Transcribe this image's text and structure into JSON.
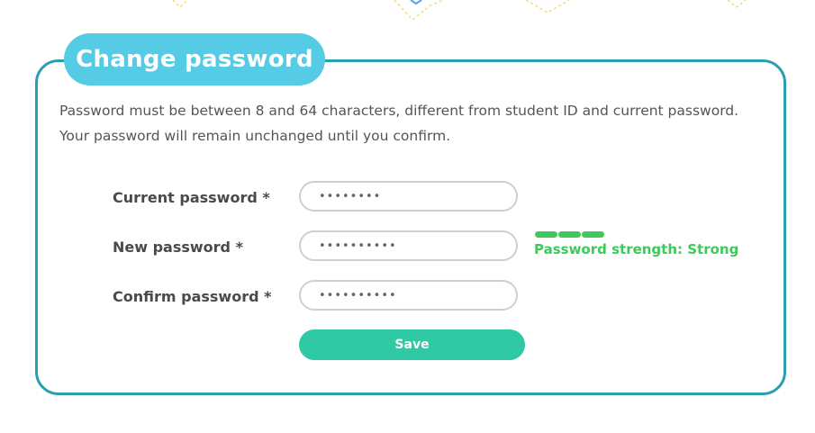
{
  "card": {
    "title": "Change password",
    "description": "Password must be between 8 and 64 characters, different from student ID and current password. Your password will remain unchanged until you confirm."
  },
  "form": {
    "current_password": {
      "label": "Current password *",
      "value": "••••••••"
    },
    "new_password": {
      "label": "New password *",
      "value": "••••••••••"
    },
    "confirm_password": {
      "label": "Confirm password *",
      "value": "••••••••••"
    },
    "strength": {
      "text": "Password strength: Strong",
      "level": 3,
      "max_level": 3
    },
    "save_label": "Save"
  },
  "colors": {
    "title_bg": "#55cbe6",
    "panel_border": "#2a9fb1",
    "strength": "#3dc95c",
    "save_button": "#30c9a5",
    "decoration_yellow": "#f3d35a",
    "decoration_blue": "#4da6e8"
  }
}
